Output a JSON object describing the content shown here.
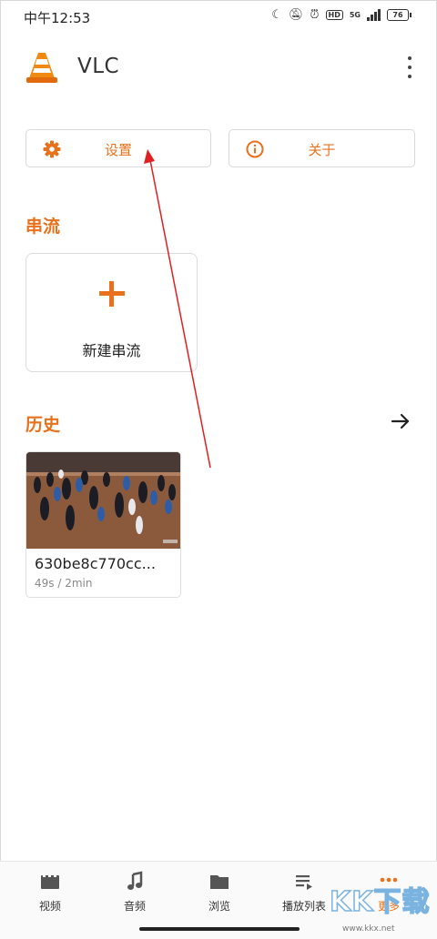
{
  "status_bar": {
    "time": "中午12:53",
    "hd": "HD",
    "network": "5G",
    "battery": "76"
  },
  "app_bar": {
    "title": "VLC"
  },
  "buttons": {
    "settings": "设置",
    "about": "关于"
  },
  "streaming": {
    "title": "串流",
    "new_stream": "新建串流"
  },
  "history": {
    "title": "历史",
    "items": [
      {
        "title": "630be8c770cc...",
        "meta": "49s / 2min"
      }
    ]
  },
  "bottom_nav": {
    "items": [
      {
        "label": "视频",
        "icon": "video-icon"
      },
      {
        "label": "音频",
        "icon": "music-note-icon"
      },
      {
        "label": "浏览",
        "icon": "folder-icon"
      },
      {
        "label": "播放列表",
        "icon": "playlist-icon"
      },
      {
        "label": "更多",
        "icon": "more-icon"
      }
    ],
    "active_index": 4
  },
  "watermark": {
    "big": "KK下载",
    "small": "www.kkx.net"
  },
  "colors": {
    "accent": "#e9711c",
    "annotation_arrow": "#e02020"
  }
}
